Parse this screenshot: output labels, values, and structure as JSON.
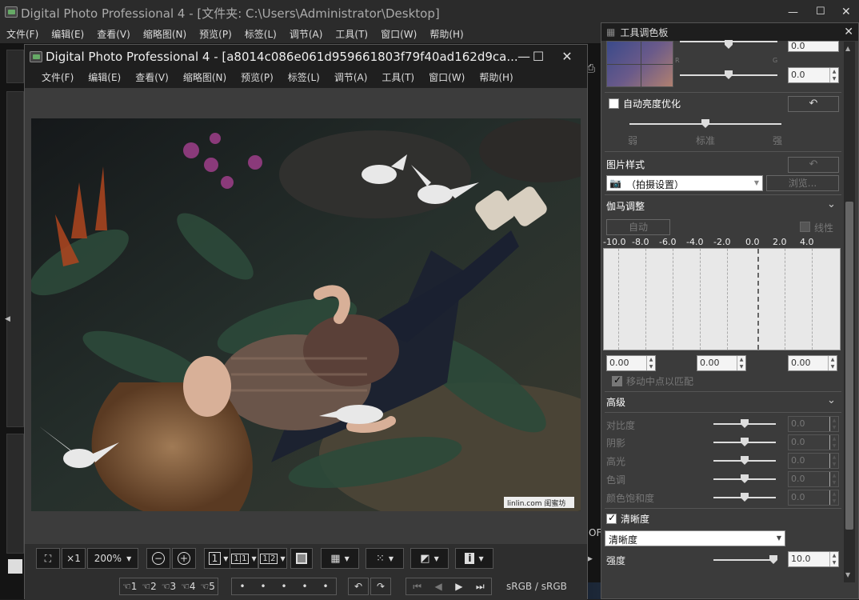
{
  "main_window": {
    "title": "Digital Photo Professional 4 - [文件夹: C:\\Users\\Administrator\\Desktop]",
    "menu": [
      "文件(F)",
      "编辑(E)",
      "查看(V)",
      "缩略图(N)",
      "预览(P)",
      "标签(L)",
      "调节(A)",
      "工具(T)",
      "窗口(W)",
      "帮助(H)"
    ],
    "controls": {
      "minimize": "—",
      "maximize": "☐",
      "close": "✕"
    },
    "side_text": "OF"
  },
  "editor_window": {
    "title": "Digital Photo Professional 4 - [a8014c086e061d959661803f79f40ad162d9ca...",
    "menu": [
      "文件(F)",
      "编辑(E)",
      "查看(V)",
      "缩略图(N)",
      "预览(P)",
      "标签(L)",
      "调节(A)",
      "工具(T)",
      "窗口(W)",
      "帮助(H)"
    ],
    "controls": {
      "minimize": "—",
      "maximize": "☐",
      "close": "✕"
    },
    "watermark": "linlin.com 闺蜜坊",
    "toolbar": {
      "fit_icon": "⛶",
      "x1_label": "×1",
      "zoom_value": "200%",
      "zoom_out": "−",
      "zoom_in": "+",
      "layout1": "1",
      "layout2": "1|1",
      "layout3": "1|2",
      "info": "i",
      "star_labels": [
        "☜1",
        "☜2",
        "☜3",
        "☜4",
        "☜5"
      ],
      "dots": [
        "•",
        "•",
        "•",
        "•",
        "•"
      ],
      "nav": [
        "⏮",
        "◀",
        "▶",
        "⏭"
      ],
      "color_space": "sRGB / sRGB"
    }
  },
  "palette": {
    "title": "工具调色板",
    "top_values": [
      "0.0",
      "0.0"
    ],
    "auto_lighting": {
      "label": "自动亮度优化",
      "levels": [
        "弱",
        "标准",
        "强"
      ],
      "checked": false
    },
    "picture_style": {
      "label": "图片样式",
      "value": "（拍摄设置）",
      "browse": "浏览..."
    },
    "gamma": {
      "label": "伽马调整",
      "auto": "自动",
      "linear": "线性",
      "axis": [
        "-10.0",
        "-8.0",
        "-6.0",
        "-4.0",
        "-2.0",
        "0.0",
        "2.0",
        "4.0"
      ],
      "values": [
        "0.00",
        "0.00",
        "0.00"
      ],
      "move_midpoint": "移动中点以匹配"
    },
    "advanced": {
      "label": "高级",
      "rows": [
        {
          "name": "对比度",
          "value": "0.0"
        },
        {
          "name": "阴影",
          "value": "0.0"
        },
        {
          "name": "高光",
          "value": "0.0"
        },
        {
          "name": "色调",
          "value": "0.0"
        },
        {
          "name": "颜色饱和度",
          "value": "0.0"
        }
      ]
    },
    "sharpness": {
      "label": "清晰度",
      "checked": true,
      "mode": "清晰度",
      "strength_label": "强度",
      "strength_value": "10.0"
    },
    "hist_labels": {
      "left": "R",
      "right": "G"
    }
  }
}
